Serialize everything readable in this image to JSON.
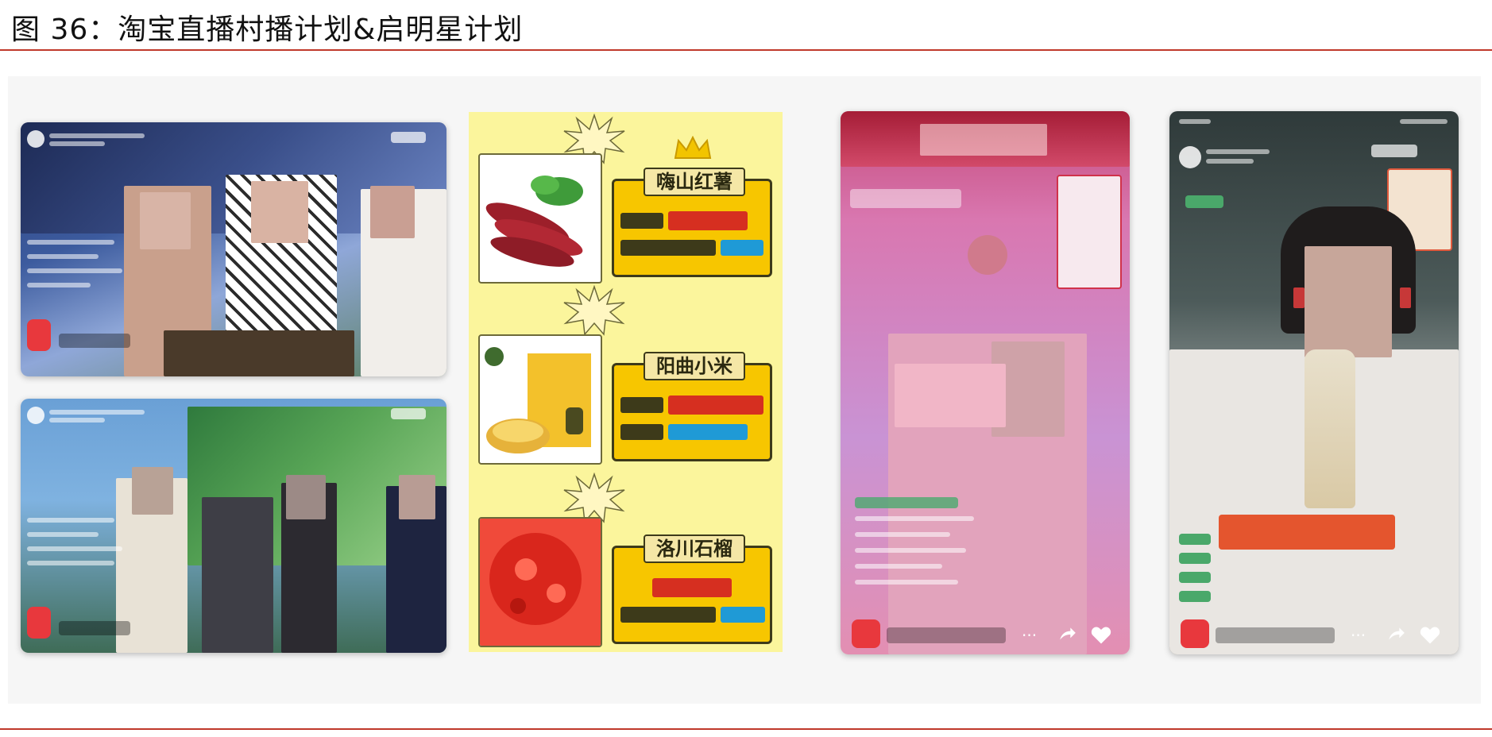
{
  "figure": {
    "title": "图 36：淘宝直播村播计划&启明星计划"
  },
  "poster": {
    "products": [
      {
        "name": "嗨山红薯"
      },
      {
        "name": "阳曲小米"
      },
      {
        "name": "洛川石榴"
      }
    ]
  },
  "colors": {
    "rule": "#c0392b",
    "poster_background": "#fbf59c",
    "label_box": "#f7c600",
    "gift_button": "#e8383d"
  },
  "icons": [
    "crown-icon",
    "burst-icon",
    "gift-icon",
    "share-icon",
    "heart-icon",
    "more-icon"
  ]
}
